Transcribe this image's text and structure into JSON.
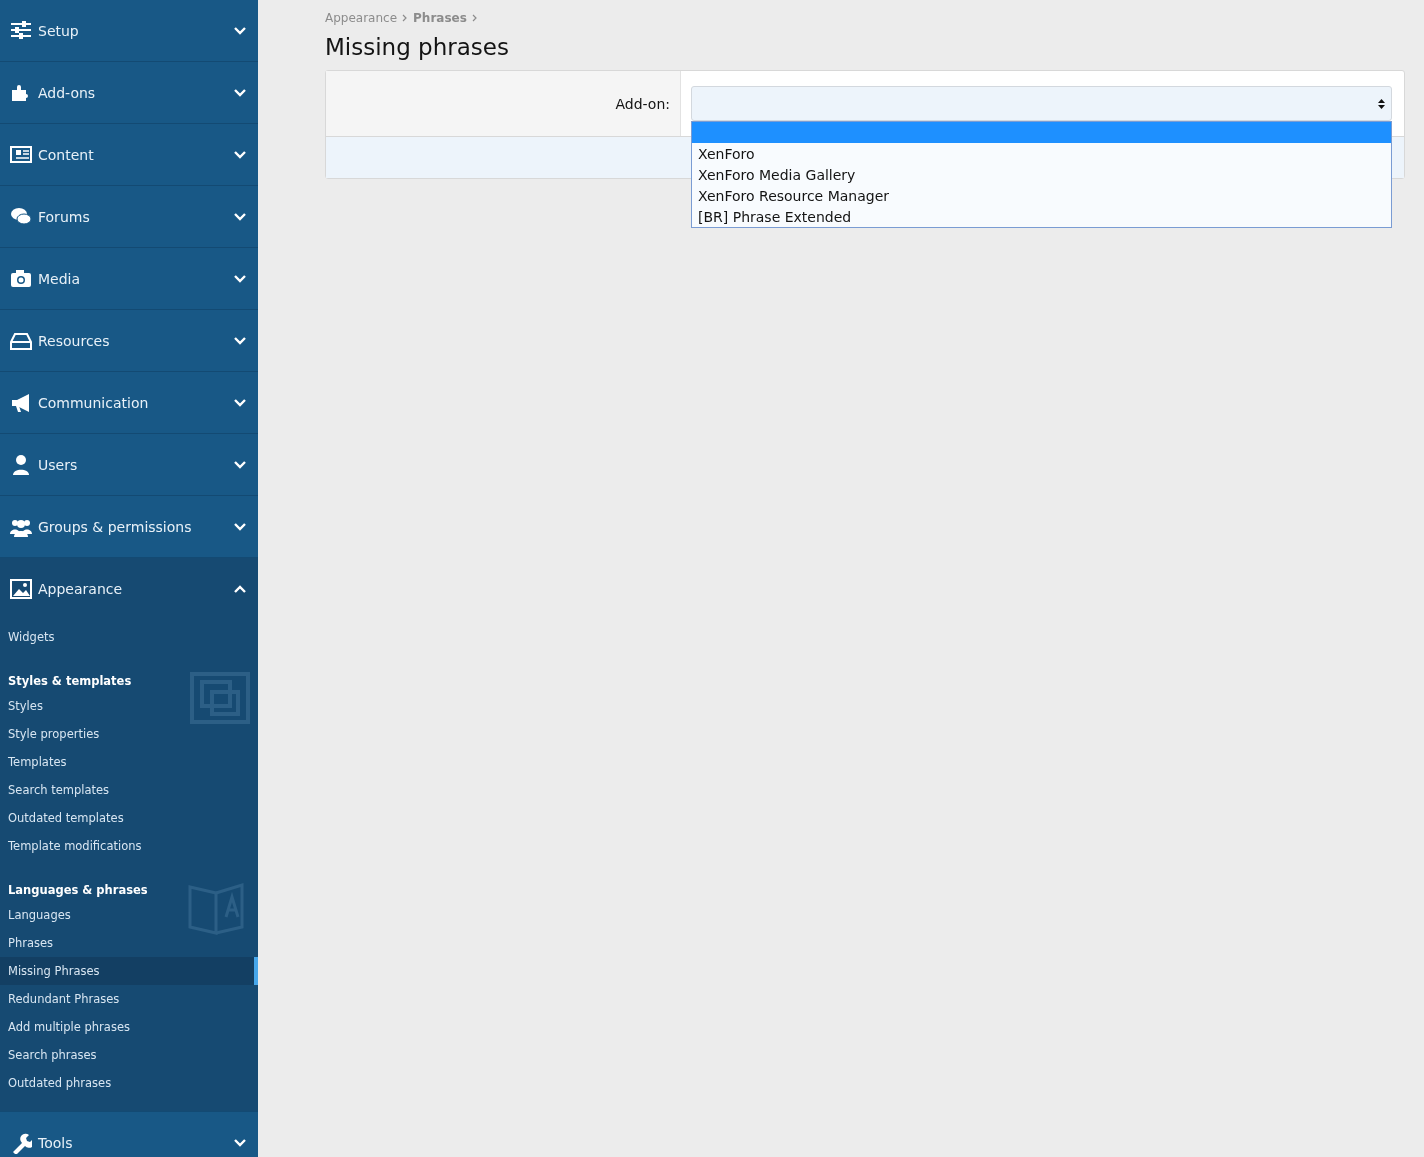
{
  "sidebar": {
    "sections": [
      {
        "label": "Setup",
        "expanded": false
      },
      {
        "label": "Add-ons",
        "expanded": false
      },
      {
        "label": "Content",
        "expanded": false
      },
      {
        "label": "Forums",
        "expanded": false
      },
      {
        "label": "Media",
        "expanded": false
      },
      {
        "label": "Resources",
        "expanded": false
      },
      {
        "label": "Communication",
        "expanded": false
      },
      {
        "label": "Users",
        "expanded": false
      },
      {
        "label": "Groups & permissions",
        "expanded": false
      },
      {
        "label": "Appearance",
        "expanded": true,
        "items": [
          {
            "kind": "link",
            "label": "Widgets",
            "selected": false
          },
          {
            "kind": "heading",
            "label": "Styles & templates"
          },
          {
            "kind": "link",
            "label": "Styles",
            "selected": false
          },
          {
            "kind": "link",
            "label": "Style properties",
            "selected": false
          },
          {
            "kind": "link",
            "label": "Templates",
            "selected": false
          },
          {
            "kind": "link",
            "label": "Search templates",
            "selected": false
          },
          {
            "kind": "link",
            "label": "Outdated templates",
            "selected": false
          },
          {
            "kind": "link",
            "label": "Template modifications",
            "selected": false
          },
          {
            "kind": "heading",
            "label": "Languages & phrases"
          },
          {
            "kind": "link",
            "label": "Languages",
            "selected": false
          },
          {
            "kind": "link",
            "label": "Phrases",
            "selected": false
          },
          {
            "kind": "link",
            "label": "Missing Phrases",
            "selected": true
          },
          {
            "kind": "link",
            "label": "Redundant Phrases",
            "selected": false
          },
          {
            "kind": "link",
            "label": "Add multiple phrases",
            "selected": false
          },
          {
            "kind": "link",
            "label": "Search phrases",
            "selected": false
          },
          {
            "kind": "link",
            "label": "Outdated phrases",
            "selected": false
          }
        ]
      },
      {
        "label": "Tools",
        "expanded": false
      }
    ]
  },
  "breadcrumb": [
    {
      "label": "Appearance",
      "bold": false
    },
    {
      "label": "Phrases",
      "bold": true
    }
  ],
  "title": "Missing phrases",
  "form": {
    "label": "Add-on:",
    "options": [
      {
        "selected": true
      },
      {
        "label": "XenForo",
        "selected": false
      },
      {
        "label": "XenForo Media Gallery",
        "selected": false
      },
      {
        "label": "XenForo Resource Manager",
        "selected": false
      },
      {
        "label": "[BR] Phrase Extended",
        "selected": false
      }
    ]
  }
}
